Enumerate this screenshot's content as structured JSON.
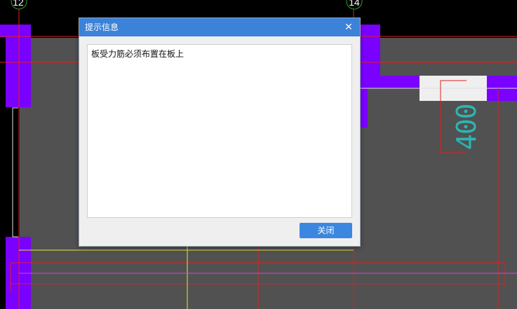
{
  "canvas": {
    "axis_labels": [
      "12",
      "14"
    ],
    "dimension_text": "400",
    "colors": {
      "background": "#000000",
      "slab": "#515151",
      "wall": "#7a00ff",
      "grid_line": "#e02020",
      "beam_line": "#e6e640",
      "rebar_line": "#e040e0",
      "dimension": "#2bb6b6"
    }
  },
  "dialog": {
    "title": "提示信息",
    "close_icon": "close-icon",
    "message": "板受力筋必须布置在板上",
    "close_button_label": "关闭"
  }
}
